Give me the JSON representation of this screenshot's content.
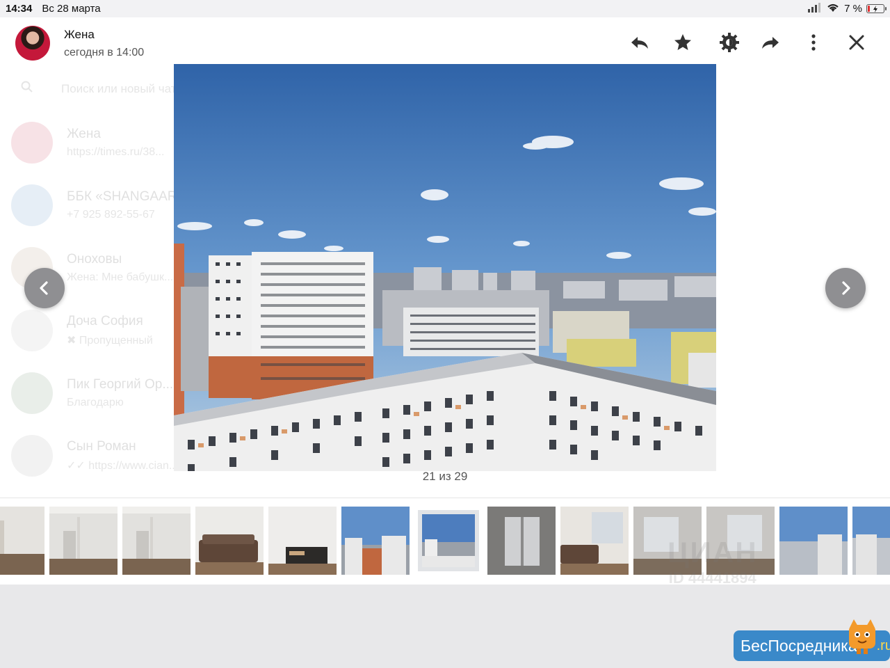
{
  "status_bar": {
    "time": "14:34",
    "date": "Вс 28 марта",
    "battery": "7 %",
    "battery_level": 0.07
  },
  "background_chats": {
    "search_placeholder": "Поиск или новый чат",
    "items": [
      {
        "title": "Жена",
        "subtitle": "https://times.ru/38..."
      },
      {
        "title": "ББК «SHANGAAR»",
        "subtitle": "+7 925 892-55-67"
      },
      {
        "title": "Оноховы",
        "subtitle": "Жена: Мне бабушк..."
      },
      {
        "title": "Доча София",
        "subtitle": "✖ Пропущенный"
      },
      {
        "title": "Пик Георгий Ор...",
        "subtitle": "Благодарю"
      },
      {
        "title": "Сын Роман",
        "subtitle": "✓✓ https://www.cian..."
      }
    ]
  },
  "header": {
    "contact_name": "Жена",
    "timestamp": "сегодня в 14:00",
    "actions": [
      "reply",
      "star",
      "settings",
      "forward",
      "more",
      "close"
    ]
  },
  "viewer": {
    "counter": "21 из 29",
    "current_index": 21,
    "total": 29
  },
  "thumbnails": [
    {
      "kind": "room-empty"
    },
    {
      "kind": "room-door"
    },
    {
      "kind": "room-door"
    },
    {
      "kind": "sofa"
    },
    {
      "kind": "tv-stand"
    },
    {
      "kind": "city"
    },
    {
      "kind": "city",
      "active": true
    },
    {
      "kind": "window-blur"
    },
    {
      "kind": "room-sofa-window"
    },
    {
      "kind": "blur-room"
    },
    {
      "kind": "blur-room"
    },
    {
      "kind": "blur-city"
    },
    {
      "kind": "blur-city"
    }
  ],
  "watermarks": {
    "cian_logo": "ЦИАН",
    "cian_id": "ID 44441894",
    "besposrednika_main": "БесПосредника",
    "besposrednika_tld": ".ru"
  },
  "colors": {
    "sky_top": "#2f63a8",
    "sky_bottom": "#9cc0e0",
    "watermark_blue": "#3a89c9"
  }
}
